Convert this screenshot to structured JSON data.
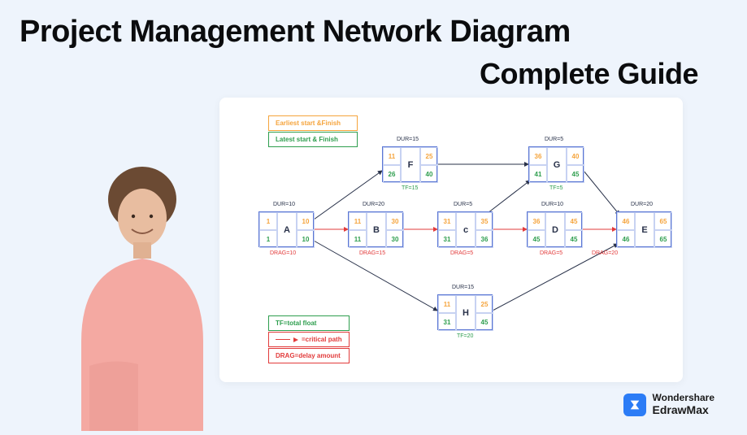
{
  "title_line1": "Project Management Network Diagram",
  "title_line2": "Complete Guide",
  "legend": {
    "earliest": "Earliest start &Finish",
    "latest": "Latest start & Finish",
    "tf": "TF=total float",
    "crit": "=critical path",
    "drag": "DRAG=delay amount"
  },
  "nodes": {
    "A": {
      "id": "A",
      "dur": "DUR=10",
      "es": "1",
      "ef": "10",
      "ls": "1",
      "lf": "10",
      "drag": "DRAG=10"
    },
    "B": {
      "id": "B",
      "dur": "DUR=20",
      "es": "11",
      "ef": "30",
      "ls": "11",
      "lf": "30",
      "drag": "DRAG=15"
    },
    "C": {
      "id": "c",
      "dur": "DUR=5",
      "es": "31",
      "ef": "35",
      "ls": "31",
      "lf": "36",
      "drag": "DRAG=5"
    },
    "D": {
      "id": "D",
      "dur": "DUR=10",
      "es": "36",
      "ef": "45",
      "ls": "45",
      "lf": "45",
      "drag": "DRAG=5"
    },
    "E": {
      "id": "E",
      "dur": "DUR=20",
      "es": "46",
      "ef": "65",
      "ls": "46",
      "lf": "65",
      "drag": "DRAG=20"
    },
    "F": {
      "id": "F",
      "dur": "DUR=15",
      "es": "11",
      "ef": "25",
      "ls": "26",
      "lf": "40",
      "tf": "TF=15"
    },
    "G": {
      "id": "G",
      "dur": "DUR=5",
      "es": "36",
      "ef": "40",
      "ls": "41",
      "lf": "45",
      "tf": "TF=5"
    },
    "H": {
      "id": "H",
      "dur": "DUR=15",
      "es": "11",
      "ef": "25",
      "ls": "31",
      "lf": "45",
      "tf": "TF=20"
    }
  },
  "brand": {
    "line1": "Wondershare",
    "line2": "EdrawMax"
  }
}
